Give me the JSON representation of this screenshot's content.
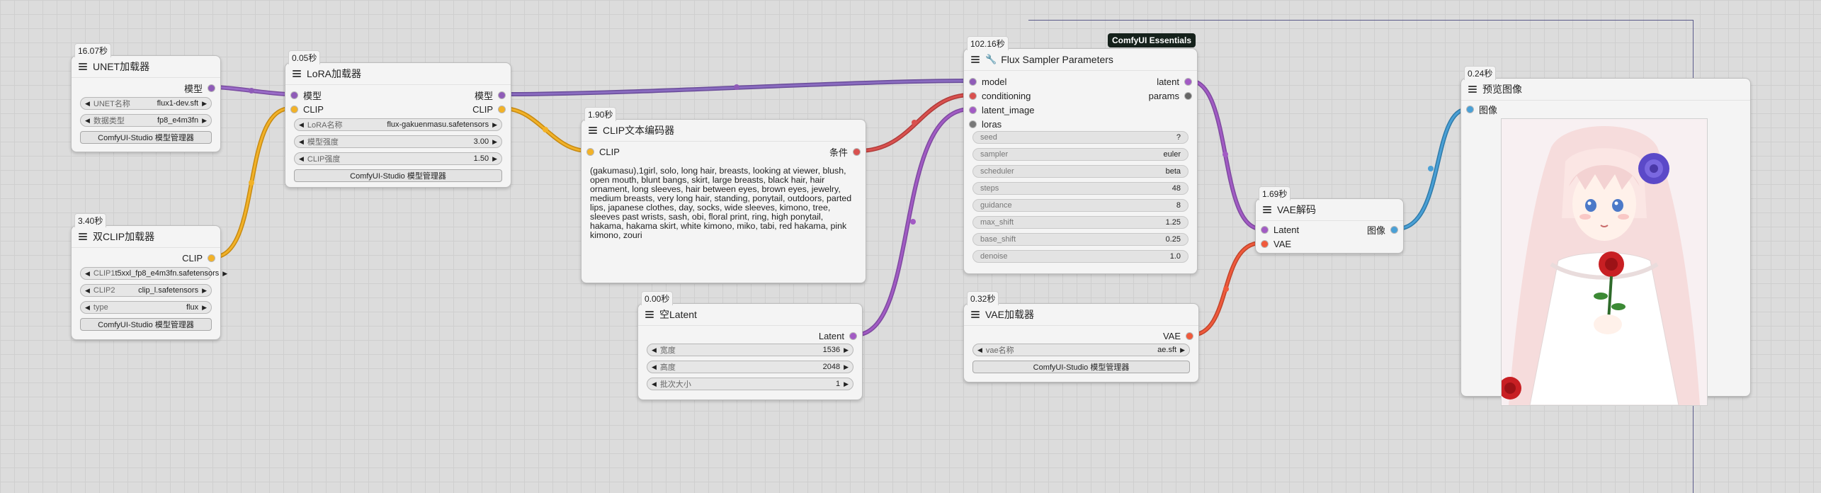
{
  "canvas": {
    "nodes": {
      "unet": {
        "time": "16.07秒",
        "title": "UNET加载器",
        "output": "模型",
        "widgets": [
          {
            "label": "UNET名称",
            "value": "flux1-dev.sft"
          },
          {
            "label": "数据类型",
            "value": "fp8_e4m3fn"
          }
        ],
        "button": "ComfyUI-Studio 模型管理器"
      },
      "dualclip": {
        "time": "3.40秒",
        "title": "双CLIP加载器",
        "output": "CLIP",
        "widgets": [
          {
            "label": "CLIP1",
            "value": "t5xxl_fp8_e4m3fn.safetensors"
          },
          {
            "label": "CLIP2",
            "value": "clip_l.safetensors"
          },
          {
            "label": "type",
            "value": "flux"
          }
        ],
        "button": "ComfyUI-Studio 模型管理器"
      },
      "lora": {
        "time": "0.05秒",
        "title": "LoRA加载器",
        "inputs": [
          "模型",
          "CLIP"
        ],
        "outputs": [
          "模型",
          "CLIP"
        ],
        "widgets": [
          {
            "label": "LoRA名称",
            "value": "flux-gakuenmasu.safetensors"
          },
          {
            "label": "模型强度",
            "value": "3.00"
          },
          {
            "label": "CLIP强度",
            "value": "1.50"
          }
        ],
        "button": "ComfyUI-Studio 模型管理器"
      },
      "clipenc": {
        "time": "1.90秒",
        "title": "CLIP文本编码器",
        "input": "CLIP",
        "output": "条件",
        "text": "(gakumasu),1girl, solo, long hair, breasts, looking at viewer, blush, open mouth, blunt bangs, skirt, large breasts, black hair, hair ornament, long sleeves, hair between eyes, brown eyes, jewelry, medium breasts, very long hair, standing, ponytail, outdoors, parted lips, japanese clothes, day, socks, wide sleeves, kimono, tree, sleeves past wrists, sash, obi, floral print, ring, high ponytail, hakama, hakama skirt, white kimono, miko, tabi, red hakama, pink kimono, zouri"
      },
      "emptylatent": {
        "time": "0.00秒",
        "title": "空Latent",
        "output": "Latent",
        "widgets": [
          {
            "label": "宽度",
            "value": "1536"
          },
          {
            "label": "高度",
            "value": "2048"
          },
          {
            "label": "批次大小",
            "value": "1"
          }
        ]
      },
      "sampler": {
        "time": "102.16秒",
        "badge": "ComfyUI Essentials",
        "title": "Flux Sampler Parameters",
        "inputs": [
          "model",
          "conditioning",
          "latent_image",
          "loras"
        ],
        "outputs": [
          "latent",
          "params"
        ],
        "widgets": [
          {
            "label": "seed",
            "value": "?"
          },
          {
            "label": "sampler",
            "value": "euler"
          },
          {
            "label": "scheduler",
            "value": "beta"
          },
          {
            "label": "steps",
            "value": "48"
          },
          {
            "label": "guidance",
            "value": "8"
          },
          {
            "label": "max_shift",
            "value": "1.25"
          },
          {
            "label": "base_shift",
            "value": "0.25"
          },
          {
            "label": "denoise",
            "value": "1.0"
          }
        ]
      },
      "vaeloader": {
        "time": "0.32秒",
        "title": "VAE加载器",
        "output": "VAE",
        "widgets": [
          {
            "label": "vae名称",
            "value": "ae.sft"
          }
        ],
        "button": "ComfyUI-Studio 模型管理器"
      },
      "vaedecode": {
        "time": "1.69秒",
        "title": "VAE解码",
        "inputs": [
          "Latent",
          "VAE"
        ],
        "output": "图像"
      },
      "preview": {
        "time": "0.24秒",
        "title": "预览图像",
        "input": "图像",
        "image_icon": "anime-girl-with-roses-image"
      }
    },
    "colors": {
      "model": "#8f5cb8",
      "clip": "#f2b228",
      "conditioning": "#d9514f",
      "latent": "#a25bc4",
      "vae": "#f05a3c",
      "image": "#4aa0d6"
    }
  }
}
